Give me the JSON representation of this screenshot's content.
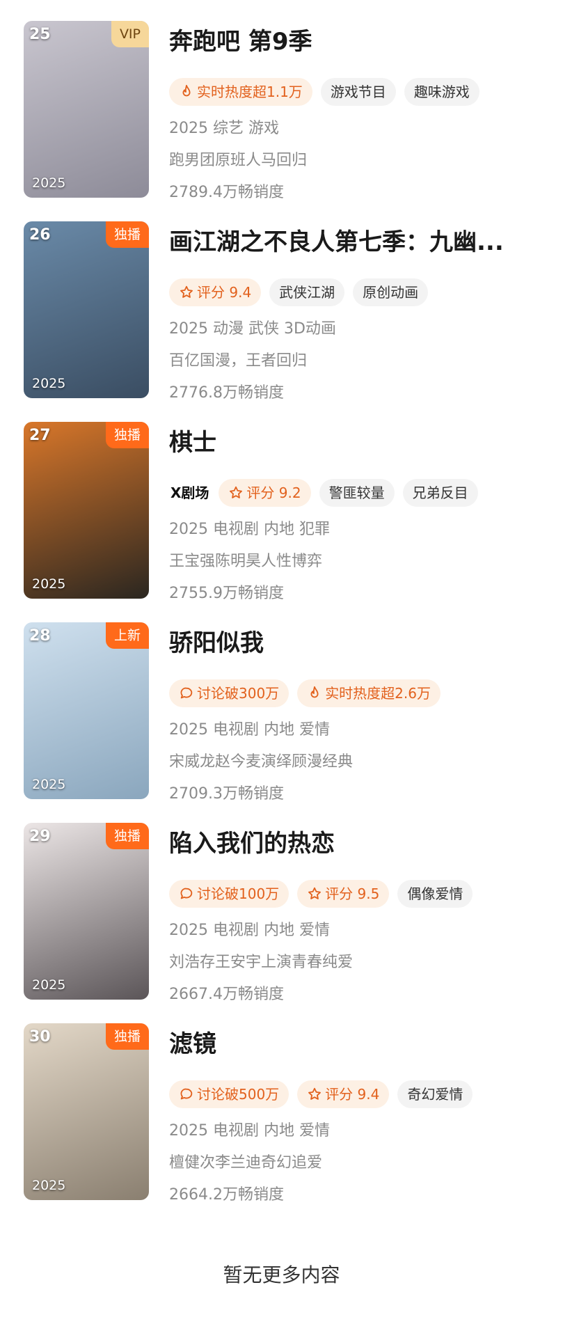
{
  "items": [
    {
      "rank": "25",
      "corner": "VIP",
      "corner_type": "vip",
      "poster_year": "2025",
      "title": "奔跑吧 第9季",
      "tags": [
        {
          "text": "实时热度超1.1万",
          "style": "hot",
          "icon": "flame-icon"
        },
        {
          "text": "游戏节目",
          "style": "plain"
        },
        {
          "text": "趣味游戏",
          "style": "plain"
        }
      ],
      "meta_line": "2025 综艺 游戏",
      "desc": "跑男团原班人马回归",
      "sales": "2789.4万畅销度",
      "colors": [
        "#c9c6cf",
        "#8d8b98"
      ]
    },
    {
      "rank": "26",
      "corner": "独播",
      "corner_type": "orange",
      "poster_year": "2025",
      "title": "画江湖之不良人第七季：九幽...",
      "tags": [
        {
          "text": "评分 9.4",
          "style": "hot",
          "icon": "star-icon"
        },
        {
          "text": "武侠江湖",
          "style": "plain"
        },
        {
          "text": "原创动画",
          "style": "plain"
        }
      ],
      "meta_line": "2025 动漫 武侠 3D动画",
      "desc": "百亿国漫，王者回归",
      "sales": "2776.8万畅销度",
      "colors": [
        "#6a8aa8",
        "#3a4d62"
      ]
    },
    {
      "rank": "27",
      "corner": "独播",
      "corner_type": "orange",
      "poster_year": "2025",
      "title": "棋士",
      "tags": [
        {
          "text": "X剧场",
          "style": "brand"
        },
        {
          "text": "评分 9.2",
          "style": "hot",
          "icon": "star-icon"
        },
        {
          "text": "警匪较量",
          "style": "plain"
        },
        {
          "text": "兄弟反目",
          "style": "plain"
        }
      ],
      "meta_line": "2025 电视剧 内地 犯罪",
      "desc": "王宝强陈明昊人性博弈",
      "sales": "2755.9万畅销度",
      "colors": [
        "#d9772a",
        "#2a2620"
      ]
    },
    {
      "rank": "28",
      "corner": "上新",
      "corner_type": "orange",
      "poster_year": "2025",
      "title": "骄阳似我",
      "tags": [
        {
          "text": "讨论破300万",
          "style": "hot",
          "icon": "chat-icon"
        },
        {
          "text": "实时热度超2.6万",
          "style": "hot",
          "icon": "flame-icon"
        }
      ],
      "meta_line": "2025 电视剧 内地 爱情",
      "desc": "宋威龙赵今麦演绎顾漫经典",
      "sales": "2709.3万畅销度",
      "colors": [
        "#cfe0ee",
        "#8aa6bd"
      ]
    },
    {
      "rank": "29",
      "corner": "独播",
      "corner_type": "orange",
      "poster_year": "2025",
      "title": "陷入我们的热恋",
      "tags": [
        {
          "text": "讨论破100万",
          "style": "hot",
          "icon": "chat-icon"
        },
        {
          "text": "评分 9.5",
          "style": "hot",
          "icon": "star-icon"
        },
        {
          "text": "偶像爱情",
          "style": "plain"
        }
      ],
      "meta_line": "2025 电视剧 内地 爱情",
      "desc": "刘浩存王安宇上演青春纯爱",
      "sales": "2667.4万畅销度",
      "colors": [
        "#ece6e6",
        "#5b5558"
      ]
    },
    {
      "rank": "30",
      "corner": "独播",
      "corner_type": "orange",
      "poster_year": "2025",
      "title": "滤镜",
      "tags": [
        {
          "text": "讨论破500万",
          "style": "hot",
          "icon": "chat-icon"
        },
        {
          "text": "评分 9.4",
          "style": "hot",
          "icon": "star-icon"
        },
        {
          "text": "奇幻爱情",
          "style": "plain"
        }
      ],
      "meta_line": "2025 电视剧 内地 爱情",
      "desc": "檀健次李兰迪奇幻追爱",
      "sales": "2664.2万畅销度",
      "colors": [
        "#e3d8c8",
        "#8a7f70"
      ]
    }
  ],
  "footer": "暂无更多内容"
}
